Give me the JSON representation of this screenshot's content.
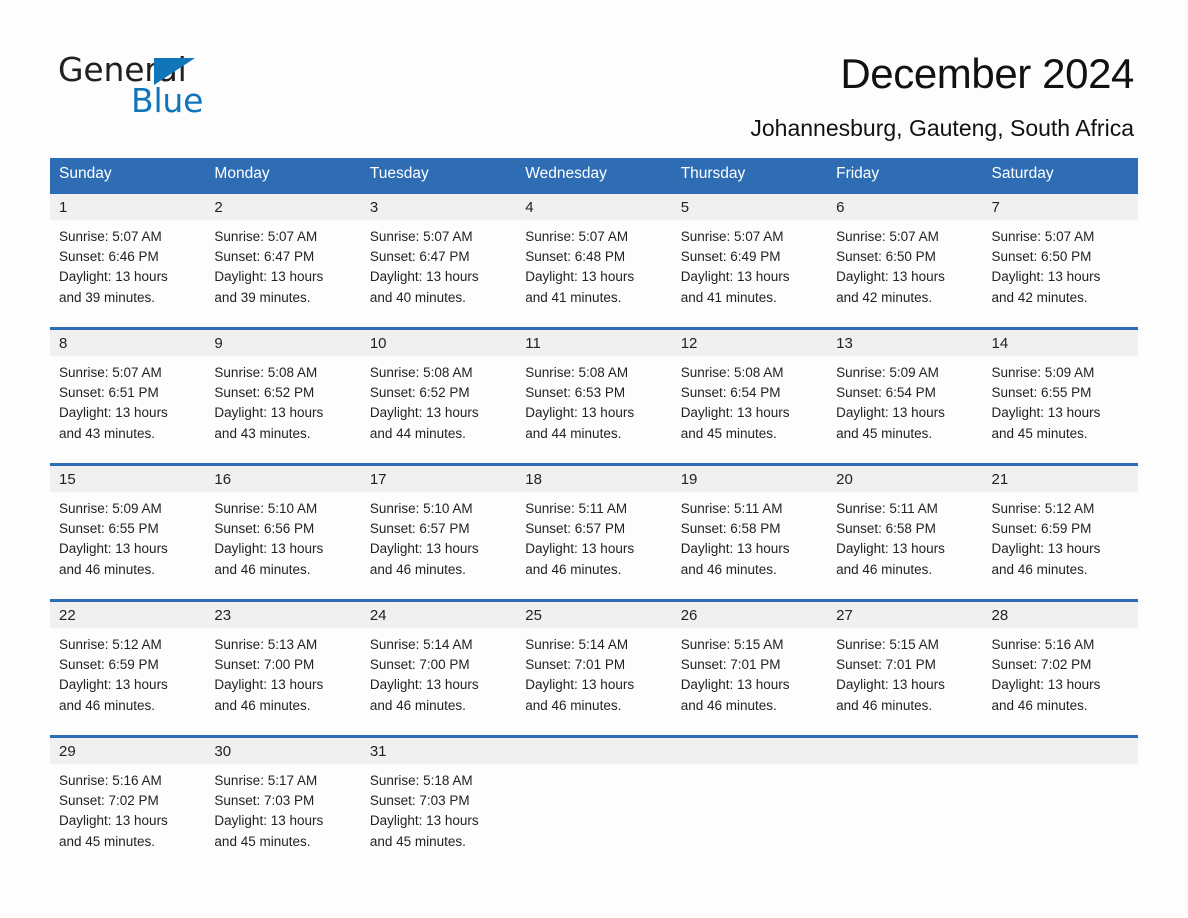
{
  "brand": {
    "name_part1": "General",
    "name_part2": "Blue",
    "triangle_color": "#1175bb",
    "text_color": "#231f20"
  },
  "header": {
    "title": "December 2024",
    "location": "Johannesburg, Gauteng, South Africa"
  },
  "theme": {
    "accent": "#2e6db4",
    "day_band": "#f0f0f0",
    "page_bg": "#fdfdfd",
    "text": "#222222",
    "header_text": "#ffffff"
  },
  "weekday_headers": [
    "Sunday",
    "Monday",
    "Tuesday",
    "Wednesday",
    "Thursday",
    "Friday",
    "Saturday"
  ],
  "labels": {
    "sunrise_prefix": "Sunrise:",
    "sunset_prefix": "Sunset:",
    "daylight_prefix": "Daylight:"
  },
  "weeks": [
    [
      {
        "day": "1",
        "sunrise": "Sunrise: 5:07 AM",
        "sunset": "Sunset: 6:46 PM",
        "daylight_l1": "Daylight: 13 hours",
        "daylight_l2": "and 39 minutes."
      },
      {
        "day": "2",
        "sunrise": "Sunrise: 5:07 AM",
        "sunset": "Sunset: 6:47 PM",
        "daylight_l1": "Daylight: 13 hours",
        "daylight_l2": "and 39 minutes."
      },
      {
        "day": "3",
        "sunrise": "Sunrise: 5:07 AM",
        "sunset": "Sunset: 6:47 PM",
        "daylight_l1": "Daylight: 13 hours",
        "daylight_l2": "and 40 minutes."
      },
      {
        "day": "4",
        "sunrise": "Sunrise: 5:07 AM",
        "sunset": "Sunset: 6:48 PM",
        "daylight_l1": "Daylight: 13 hours",
        "daylight_l2": "and 41 minutes."
      },
      {
        "day": "5",
        "sunrise": "Sunrise: 5:07 AM",
        "sunset": "Sunset: 6:49 PM",
        "daylight_l1": "Daylight: 13 hours",
        "daylight_l2": "and 41 minutes."
      },
      {
        "day": "6",
        "sunrise": "Sunrise: 5:07 AM",
        "sunset": "Sunset: 6:50 PM",
        "daylight_l1": "Daylight: 13 hours",
        "daylight_l2": "and 42 minutes."
      },
      {
        "day": "7",
        "sunrise": "Sunrise: 5:07 AM",
        "sunset": "Sunset: 6:50 PM",
        "daylight_l1": "Daylight: 13 hours",
        "daylight_l2": "and 42 minutes."
      }
    ],
    [
      {
        "day": "8",
        "sunrise": "Sunrise: 5:07 AM",
        "sunset": "Sunset: 6:51 PM",
        "daylight_l1": "Daylight: 13 hours",
        "daylight_l2": "and 43 minutes."
      },
      {
        "day": "9",
        "sunrise": "Sunrise: 5:08 AM",
        "sunset": "Sunset: 6:52 PM",
        "daylight_l1": "Daylight: 13 hours",
        "daylight_l2": "and 43 minutes."
      },
      {
        "day": "10",
        "sunrise": "Sunrise: 5:08 AM",
        "sunset": "Sunset: 6:52 PM",
        "daylight_l1": "Daylight: 13 hours",
        "daylight_l2": "and 44 minutes."
      },
      {
        "day": "11",
        "sunrise": "Sunrise: 5:08 AM",
        "sunset": "Sunset: 6:53 PM",
        "daylight_l1": "Daylight: 13 hours",
        "daylight_l2": "and 44 minutes."
      },
      {
        "day": "12",
        "sunrise": "Sunrise: 5:08 AM",
        "sunset": "Sunset: 6:54 PM",
        "daylight_l1": "Daylight: 13 hours",
        "daylight_l2": "and 45 minutes."
      },
      {
        "day": "13",
        "sunrise": "Sunrise: 5:09 AM",
        "sunset": "Sunset: 6:54 PM",
        "daylight_l1": "Daylight: 13 hours",
        "daylight_l2": "and 45 minutes."
      },
      {
        "day": "14",
        "sunrise": "Sunrise: 5:09 AM",
        "sunset": "Sunset: 6:55 PM",
        "daylight_l1": "Daylight: 13 hours",
        "daylight_l2": "and 45 minutes."
      }
    ],
    [
      {
        "day": "15",
        "sunrise": "Sunrise: 5:09 AM",
        "sunset": "Sunset: 6:55 PM",
        "daylight_l1": "Daylight: 13 hours",
        "daylight_l2": "and 46 minutes."
      },
      {
        "day": "16",
        "sunrise": "Sunrise: 5:10 AM",
        "sunset": "Sunset: 6:56 PM",
        "daylight_l1": "Daylight: 13 hours",
        "daylight_l2": "and 46 minutes."
      },
      {
        "day": "17",
        "sunrise": "Sunrise: 5:10 AM",
        "sunset": "Sunset: 6:57 PM",
        "daylight_l1": "Daylight: 13 hours",
        "daylight_l2": "and 46 minutes."
      },
      {
        "day": "18",
        "sunrise": "Sunrise: 5:11 AM",
        "sunset": "Sunset: 6:57 PM",
        "daylight_l1": "Daylight: 13 hours",
        "daylight_l2": "and 46 minutes."
      },
      {
        "day": "19",
        "sunrise": "Sunrise: 5:11 AM",
        "sunset": "Sunset: 6:58 PM",
        "daylight_l1": "Daylight: 13 hours",
        "daylight_l2": "and 46 minutes."
      },
      {
        "day": "20",
        "sunrise": "Sunrise: 5:11 AM",
        "sunset": "Sunset: 6:58 PM",
        "daylight_l1": "Daylight: 13 hours",
        "daylight_l2": "and 46 minutes."
      },
      {
        "day": "21",
        "sunrise": "Sunrise: 5:12 AM",
        "sunset": "Sunset: 6:59 PM",
        "daylight_l1": "Daylight: 13 hours",
        "daylight_l2": "and 46 minutes."
      }
    ],
    [
      {
        "day": "22",
        "sunrise": "Sunrise: 5:12 AM",
        "sunset": "Sunset: 6:59 PM",
        "daylight_l1": "Daylight: 13 hours",
        "daylight_l2": "and 46 minutes."
      },
      {
        "day": "23",
        "sunrise": "Sunrise: 5:13 AM",
        "sunset": "Sunset: 7:00 PM",
        "daylight_l1": "Daylight: 13 hours",
        "daylight_l2": "and 46 minutes."
      },
      {
        "day": "24",
        "sunrise": "Sunrise: 5:14 AM",
        "sunset": "Sunset: 7:00 PM",
        "daylight_l1": "Daylight: 13 hours",
        "daylight_l2": "and 46 minutes."
      },
      {
        "day": "25",
        "sunrise": "Sunrise: 5:14 AM",
        "sunset": "Sunset: 7:01 PM",
        "daylight_l1": "Daylight: 13 hours",
        "daylight_l2": "and 46 minutes."
      },
      {
        "day": "26",
        "sunrise": "Sunrise: 5:15 AM",
        "sunset": "Sunset: 7:01 PM",
        "daylight_l1": "Daylight: 13 hours",
        "daylight_l2": "and 46 minutes."
      },
      {
        "day": "27",
        "sunrise": "Sunrise: 5:15 AM",
        "sunset": "Sunset: 7:01 PM",
        "daylight_l1": "Daylight: 13 hours",
        "daylight_l2": "and 46 minutes."
      },
      {
        "day": "28",
        "sunrise": "Sunrise: 5:16 AM",
        "sunset": "Sunset: 7:02 PM",
        "daylight_l1": "Daylight: 13 hours",
        "daylight_l2": "and 46 minutes."
      }
    ],
    [
      {
        "day": "29",
        "sunrise": "Sunrise: 5:16 AM",
        "sunset": "Sunset: 7:02 PM",
        "daylight_l1": "Daylight: 13 hours",
        "daylight_l2": "and 45 minutes."
      },
      {
        "day": "30",
        "sunrise": "Sunrise: 5:17 AM",
        "sunset": "Sunset: 7:03 PM",
        "daylight_l1": "Daylight: 13 hours",
        "daylight_l2": "and 45 minutes."
      },
      {
        "day": "31",
        "sunrise": "Sunrise: 5:18 AM",
        "sunset": "Sunset: 7:03 PM",
        "daylight_l1": "Daylight: 13 hours",
        "daylight_l2": "and 45 minutes."
      },
      {
        "day": "",
        "sunrise": "",
        "sunset": "",
        "daylight_l1": "",
        "daylight_l2": ""
      },
      {
        "day": "",
        "sunrise": "",
        "sunset": "",
        "daylight_l1": "",
        "daylight_l2": ""
      },
      {
        "day": "",
        "sunrise": "",
        "sunset": "",
        "daylight_l1": "",
        "daylight_l2": ""
      },
      {
        "day": "",
        "sunrise": "",
        "sunset": "",
        "daylight_l1": "",
        "daylight_l2": ""
      }
    ]
  ]
}
